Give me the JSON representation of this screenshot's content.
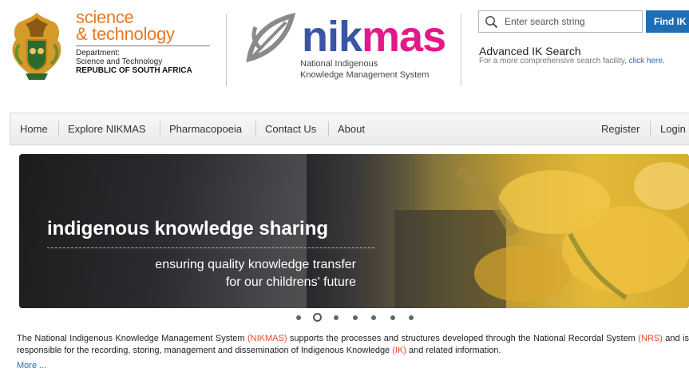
{
  "header": {
    "dst_logo": {
      "line1": "science",
      "line2": "& technology",
      "department": "Department:",
      "dept_name": "Science and Technology",
      "country": "REPUBLIC OF SOUTH AFRICA"
    },
    "nikmas_logo": {
      "word_a": "nik",
      "word_b": "mas",
      "sub1": "National Indigenous",
      "sub2": "Knowledge Management System"
    },
    "search": {
      "placeholder": "Enter search string",
      "value": "",
      "button_label": "Find IK"
    },
    "advanced": {
      "title": "Advanced IK Search",
      "description": "For a more comprehensive search facility,",
      "link_text": "click here."
    }
  },
  "nav": {
    "left_items": [
      "Home",
      "Explore NIKMAS",
      "Pharmacopoeia",
      "Contact Us",
      "About"
    ],
    "right_items": [
      "Register",
      "Login"
    ]
  },
  "banner": {
    "main": "indigenous knowledge sharing",
    "sub1": "ensuring quality knowledge transfer",
    "sub2": "for our childrens' future"
  },
  "slider": {
    "dot_count": 7,
    "active_index": 1
  },
  "intro": {
    "p1": "The National Indigenous Knowledge Management System ",
    "t1": "(NIKMAS)",
    "p2": " supports the processes and structures developed through the National Recordal System ",
    "t2": "(NRS)",
    "p3": " and is responsible for the recording, storing, management and dissemination of Indigenous Knowledge ",
    "t3": "(IK)",
    "p4": " and related information.",
    "more": "More ..."
  },
  "colors": {
    "dst_orange": "#e87722",
    "nikmas_blue": "#3a55a4",
    "nikmas_magenta": "#e1198a",
    "link_blue": "#1f6eb5",
    "acronym_red": "#e34b2a"
  }
}
